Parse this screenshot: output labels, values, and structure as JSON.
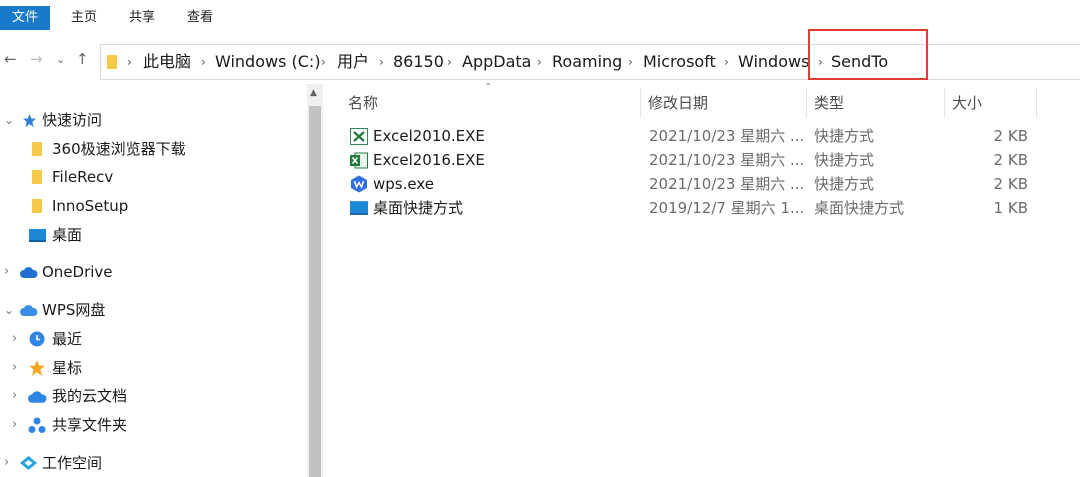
{
  "window": {
    "title": "SendTo"
  },
  "ribbon": {
    "tabs": [
      "文件",
      "主页",
      "共享",
      "查看"
    ]
  },
  "address": {
    "crumbs": [
      "此电脑",
      "Windows (C:)",
      "用户",
      "86150",
      "AppData",
      "Roaming",
      "Microsoft",
      "Windows",
      "SendTo"
    ]
  },
  "sidebar": {
    "quick_access": "快速访问",
    "quick_items": [
      "360极速浏览器下载",
      "FileRecv",
      "InnoSetup",
      "桌面"
    ],
    "onedrive": "OneDrive",
    "wps": "WPS网盘",
    "wps_items": [
      "最近",
      "星标",
      "我的云文档",
      "共享文件夹"
    ],
    "workspace": "工作空间"
  },
  "columns": {
    "name": "名称",
    "date": "修改日期",
    "type": "类型",
    "size": "大小"
  },
  "files": [
    {
      "name": "Excel2010.EXE",
      "date": "2021/10/23 星期六 ...",
      "type": "快捷方式",
      "size": "2 KB",
      "icon": "excel-2010-icon"
    },
    {
      "name": "Excel2016.EXE",
      "date": "2021/10/23 星期六 ...",
      "type": "快捷方式",
      "size": "2 KB",
      "icon": "excel-2016-icon"
    },
    {
      "name": "wps.exe",
      "date": "2021/10/23 星期六 ...",
      "type": "快捷方式",
      "size": "2 KB",
      "icon": "wps-icon"
    },
    {
      "name": "桌面快捷方式",
      "date": "2019/12/7 星期六 1...",
      "type": "桌面快捷方式",
      "size": "1 KB",
      "icon": "desktop-shortcut-icon"
    }
  ],
  "colors": {
    "accent": "#1979ca",
    "highlight": "#e53935",
    "folder": "#f7c948"
  }
}
